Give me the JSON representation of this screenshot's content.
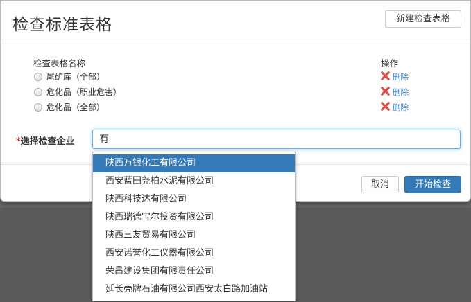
{
  "modal": {
    "title": "检查标准表格",
    "new_button": "新建检查表格"
  },
  "table": {
    "name_header": "检查表格名称",
    "op_header": "操作",
    "rows": [
      {
        "label": "尾矿库（全部）",
        "action": "删除"
      },
      {
        "label": "危化品（职业危害）",
        "action": "删除"
      },
      {
        "label": "危化品（全部）",
        "action": "删除"
      }
    ]
  },
  "company": {
    "required_mark": "*",
    "label": "选择检查企业",
    "value": "有"
  },
  "footer": {
    "cancel": "取消",
    "start": "开始检查"
  },
  "dropdown": {
    "items": [
      "陕西万银化工有限公司",
      "西安蓝田尧柏水泥有限公司",
      "陕西科技达有限公司",
      "陕西瑞德宝尔投资有限公司",
      "陕西三友贸易有限公司",
      "西安诺誉化工仪器有限公司",
      "荣昌建设集团有限责任公司",
      "延长壳牌石油有限公司西安太白路加油站"
    ],
    "active_index": 0
  },
  "colors": {
    "primary": "#337ab7",
    "delete_icon": "#d9534f"
  }
}
